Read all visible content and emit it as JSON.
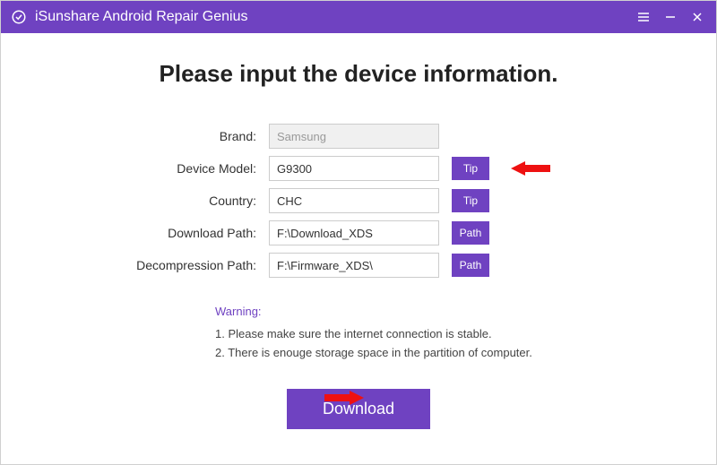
{
  "titlebar": {
    "app_name": "iSunshare Android Repair Genius"
  },
  "heading": "Please input the device information.",
  "form": {
    "brand": {
      "label": "Brand:",
      "value": "Samsung"
    },
    "model": {
      "label": "Device Model:",
      "value": "G9300",
      "btn": "Tip"
    },
    "country": {
      "label": "Country:",
      "value": "CHC",
      "btn": "Tip"
    },
    "download_path": {
      "label": "Download Path:",
      "value": "F:\\Download_XDS",
      "btn": "Path"
    },
    "decompression_path": {
      "label": "Decompression Path:",
      "value": "F:\\Firmware_XDS\\",
      "btn": "Path"
    }
  },
  "warning": {
    "title": "Warning:",
    "line1": "1. Please make sure the internet connection is stable.",
    "line2": "2. There is enouge storage space in the partition of computer."
  },
  "download_label": "Download"
}
